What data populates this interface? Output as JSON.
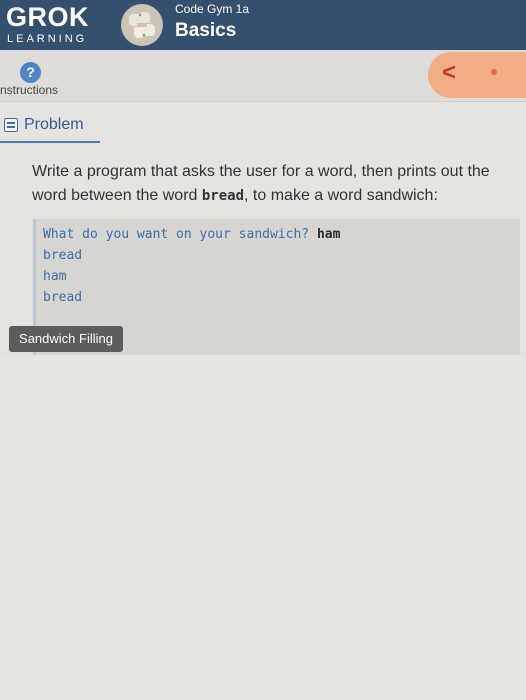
{
  "header": {
    "logo_main": "GROK",
    "logo_sub": "LEARNING",
    "course_subtitle": "Code Gym 1a",
    "course_title": "Basics",
    "python_icon": "python-logo-icon"
  },
  "subbar": {
    "help_icon": "question-icon",
    "help_glyph": "?",
    "instructions_label": "nstructions",
    "back_glyph": "<"
  },
  "tab": {
    "label": "Problem",
    "icon": "document-icon"
  },
  "problem": {
    "text_before": "Write a program that asks the user for a word, then prints out the word between the word ",
    "bold_word": "bread",
    "text_after": ", to make a word sandwich:"
  },
  "example": {
    "prompt": "What do you want on your sandwich? ",
    "input": "ham",
    "lines": [
      "bread",
      "ham",
      "bread"
    ]
  },
  "filling_button": {
    "label": "Sandwich Filling"
  },
  "colors": {
    "header_bg": "#34506e",
    "accent_blue": "#3a6fa8",
    "nav_pill": "#f2ad87",
    "nav_arrow": "#c43a24"
  }
}
